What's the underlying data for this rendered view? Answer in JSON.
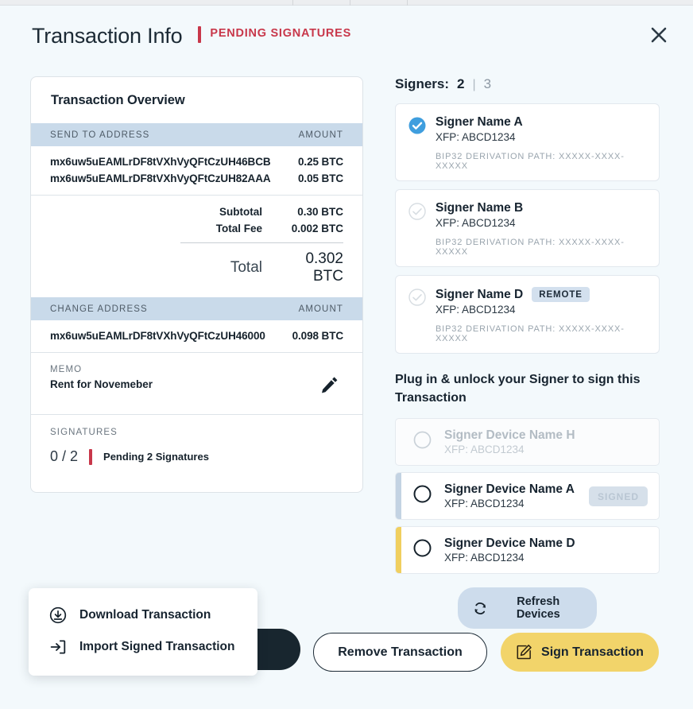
{
  "header": {
    "title": "Transaction Info",
    "status": "PENDING SIGNATURES",
    "status_color": "#c8374a",
    "close_icon": "close-icon"
  },
  "overview": {
    "card_title": "Transaction Overview",
    "send_section": {
      "col_address": "SEND TO ADDRESS",
      "col_amount": "AMOUNT",
      "rows": [
        {
          "address": "mx6uw5uEAMLrDF8tVXhVyQFtCzUH46BCB",
          "amount": "0.25 BTC"
        },
        {
          "address": "mx6uw5uEAMLrDF8tVXhVyQFtCzUH82AAA",
          "amount": "0.05 BTC"
        }
      ]
    },
    "totals": {
      "subtotal_label": "Subtotal",
      "subtotal_value": "0.30 BTC",
      "fee_label": "Total Fee",
      "fee_value": "0.002 BTC",
      "total_label": "Total",
      "total_value": "0.302 BTC"
    },
    "change_section": {
      "col_address": "CHANGE ADDRESS",
      "col_amount": "AMOUNT",
      "rows": [
        {
          "address": "mx6uw5uEAMLrDF8tVXhVyQFtCzUH46000",
          "amount": "0.098 BTC"
        }
      ]
    },
    "memo": {
      "label": "MEMO",
      "value": "Rent for Novemeber",
      "edit_icon": "pencil-icon"
    },
    "signatures": {
      "label": "SIGNATURES",
      "count": "0 / 2",
      "status": "Pending 2 Signatures",
      "accent_color": "#c8374a"
    }
  },
  "signers": {
    "heading_label": "Signers:",
    "current": "2",
    "separator": "|",
    "total": "3",
    "checked_color": "#3f9ede",
    "items": [
      {
        "name": "Signer Name A",
        "xfp": "XFP: ABCD1234",
        "path": "BIP32 DERIVATION PATH: XXXXX-XXXX-XXXXX",
        "checked": true,
        "badge": null,
        "check_icon": "check-circle-filled-icon"
      },
      {
        "name": "Signer Name B",
        "xfp": "XFP: ABCD1234",
        "path": "BIP32 DERIVATION PATH: XXXXX-XXXX-XXXXX",
        "checked": false,
        "badge": null,
        "check_icon": "check-circle-outline-icon"
      },
      {
        "name": "Signer Name D",
        "xfp": "XFP: ABCD1234",
        "path": "BIP32 DERIVATION PATH: XXXXX-XXXX-XXXXX",
        "checked": false,
        "badge": "REMOTE",
        "check_icon": "check-circle-outline-icon"
      }
    ]
  },
  "devices": {
    "heading": "Plug in & unlock your Signer to sign this Transaction",
    "items": [
      {
        "name": "Signer Device Name H",
        "xfp": "XFP: ABCD1234",
        "badge": null,
        "accent_color": "transparent",
        "disabled": true,
        "radio_icon": "radio-empty-icon"
      },
      {
        "name": "Signer Device Name A",
        "xfp": "XFP: ABCD1234",
        "badge": "SIGNED",
        "accent_color": "#c3d3e3",
        "disabled": false,
        "radio_icon": "radio-empty-icon"
      },
      {
        "name": "Signer Device Name D",
        "xfp": "XFP: ABCD1234",
        "badge": null,
        "accent_color": "#f0cf5f",
        "disabled": false,
        "radio_icon": "radio-empty-icon"
      }
    ],
    "refresh_label": "Refresh Devices",
    "refresh_icon": "refresh-icon"
  },
  "footer": {
    "remove_label": "Remove Transaction",
    "sign_label": "Sign Transaction",
    "sign_icon": "edit-square-icon",
    "sign_color": "#f2d46a",
    "dark_button_color": "#18262f"
  },
  "menu": {
    "items": [
      {
        "label": "Download Transaction",
        "icon": "download-circle-icon"
      },
      {
        "label": "Import Signed Transaction",
        "icon": "import-box-icon"
      }
    ]
  }
}
